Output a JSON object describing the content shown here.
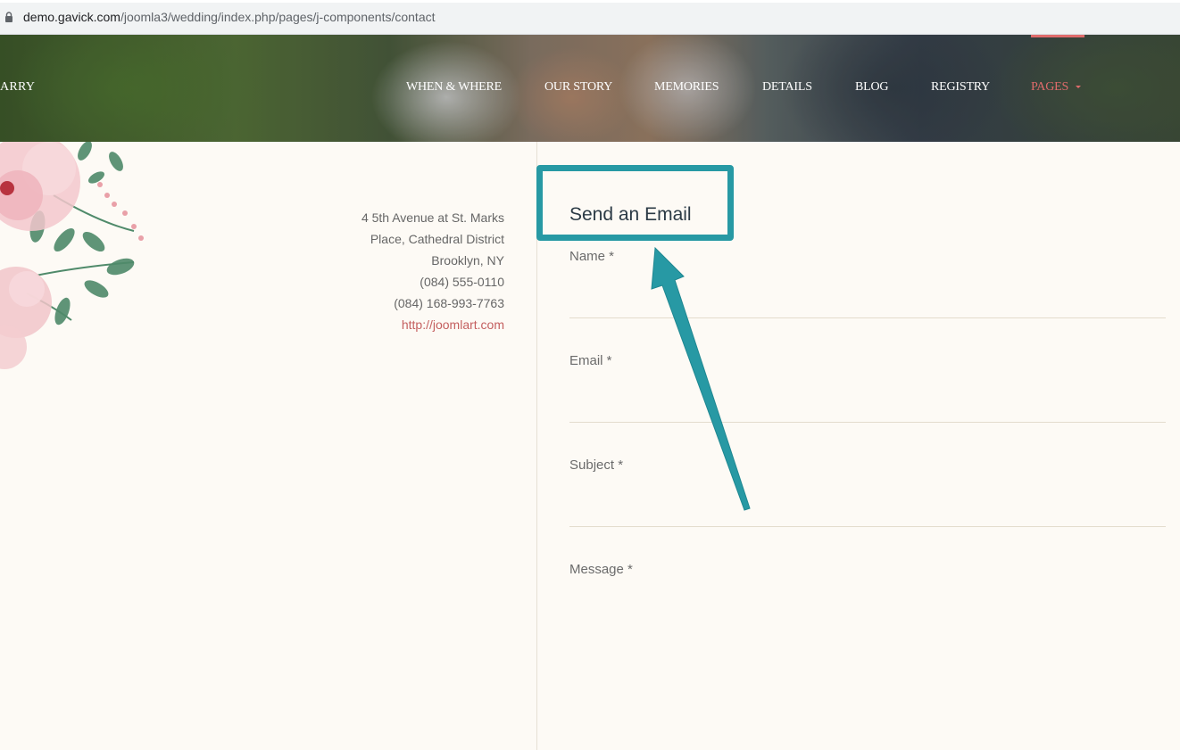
{
  "browser": {
    "url_host": "demo.gavick.com",
    "url_path": "/joomla3/wedding/index.php/pages/j-components/contact"
  },
  "header": {
    "brand_partial": "ARRY",
    "nav": [
      {
        "label": "WHEN & WHERE"
      },
      {
        "label": "OUR STORY"
      },
      {
        "label": "MEMORIES"
      },
      {
        "label": "DETAILS"
      },
      {
        "label": "BLOG"
      },
      {
        "label": "REGISTRY"
      },
      {
        "label": "PAGES",
        "active": true
      }
    ]
  },
  "contact": {
    "address_line1": "4 5th Avenue at St. Marks",
    "address_line2": "Place, Cathedral District",
    "city": "Brooklyn, NY",
    "phone1": "(084) 555-0110",
    "phone2": "(084) 168-993-7763",
    "website": "http://joomlart.com"
  },
  "form": {
    "title": "Send an Email",
    "name_label": "Name *",
    "email_label": "Email *",
    "subject_label": "Subject *",
    "message_label": "Message *",
    "name_value": "",
    "email_value": "",
    "subject_value": ""
  },
  "colors": {
    "accent": "#e06b6b",
    "link": "#c45f5f",
    "annotation": "#2799a4",
    "background": "#fdfaf5"
  },
  "icons": {
    "lock": "lock-icon",
    "caret": "caret-down-icon"
  }
}
